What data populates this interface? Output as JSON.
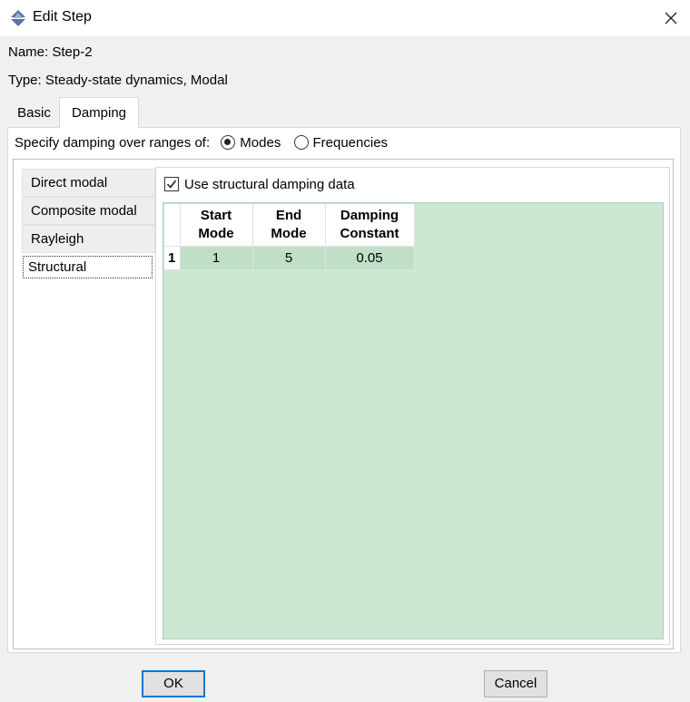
{
  "window": {
    "title": "Edit Step",
    "icon": "step-app-icon"
  },
  "close_icon": "close-icon",
  "info": {
    "name_label": "Name:",
    "name_value": "Step-2",
    "type_label": "Type:",
    "type_value": "Steady-state dynamics, Modal"
  },
  "tabs": [
    {
      "label": "Basic",
      "selected": false
    },
    {
      "label": "Damping",
      "selected": true
    }
  ],
  "range": {
    "label": "Specify damping over ranges of:",
    "options": [
      {
        "label": "Modes",
        "checked": true
      },
      {
        "label": "Frequencies",
        "checked": false
      }
    ]
  },
  "side_list": [
    {
      "label": "Direct modal",
      "selected": false
    },
    {
      "label": "Composite modal",
      "selected": false
    },
    {
      "label": "Rayleigh",
      "selected": false
    },
    {
      "label": "Structural",
      "selected": true
    }
  ],
  "structural": {
    "use_label": "Use structural damping data",
    "use_checked": true,
    "columns": [
      {
        "line1": "Start",
        "line2": "Mode"
      },
      {
        "line1": "End",
        "line2": "Mode"
      },
      {
        "line1": "Damping",
        "line2": "Constant"
      }
    ],
    "rows": [
      {
        "index": "1",
        "cells": [
          "1",
          "5",
          "0.05"
        ]
      }
    ],
    "table_bg": "#cce8d2"
  },
  "buttons": {
    "ok": "OK",
    "cancel": "Cancel"
  },
  "colors": {
    "focus_border": "#0078d7",
    "table_bg": "#cce8d2",
    "cell_bg": "#bfe0c6"
  }
}
